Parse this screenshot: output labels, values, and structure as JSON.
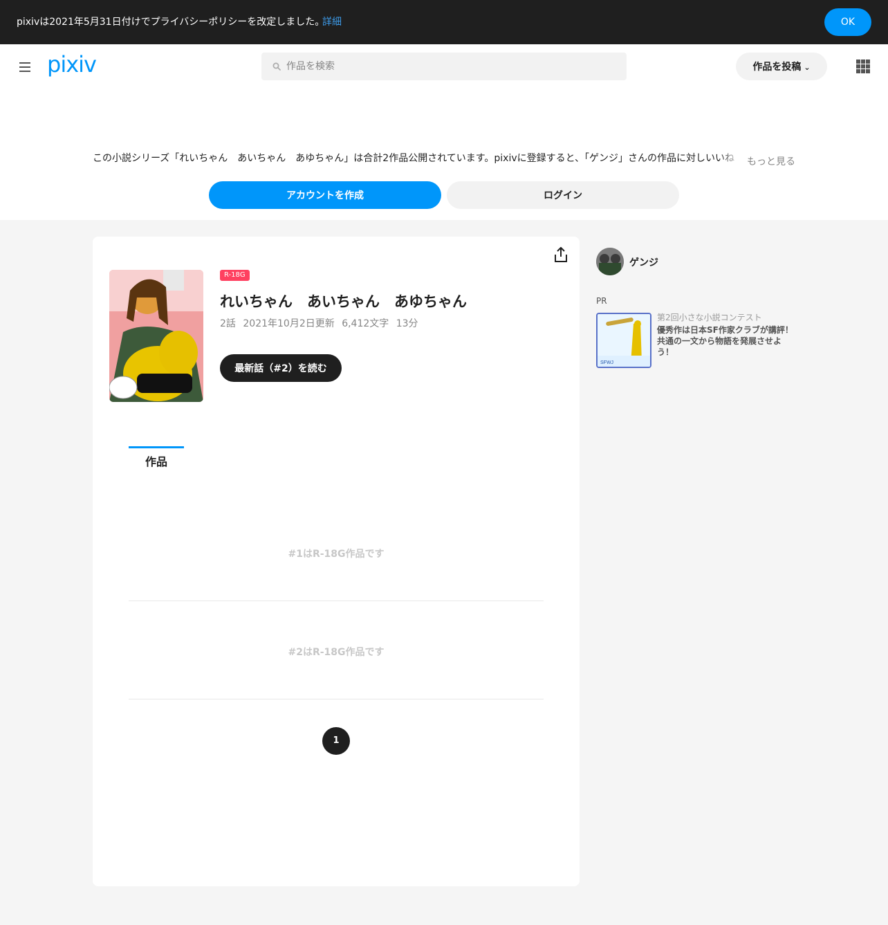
{
  "notice": {
    "text": "pixivは2021年5月31日付けでプライバシーポリシーを改定しました。",
    "link": "詳細",
    "ok": "OK"
  },
  "header": {
    "logo": "pixiv",
    "search_placeholder": "作品を検索",
    "post_button": "作品を投稿"
  },
  "promo": {
    "text": "この小説シリーズ「れいちゃん　あいちゃん　あゆちゃん」は合計2作品公開されています。pixivに登録すると、「ゲンジ」さんの作品に対しいいね",
    "more": "もっと見る",
    "create_account": "アカウントを作成",
    "login": "ログイン"
  },
  "series": {
    "rating": "R-18G",
    "title": "れいちゃん　あいちゃん　あゆちゃん",
    "episodes_count": "2話",
    "updated": "2021年10月2日更新",
    "chars": "6,412文字",
    "read_time": "13分",
    "read_latest": "最新話（#2）を読む"
  },
  "tabs": {
    "works": "作品"
  },
  "episodes": [
    {
      "text": "#1はR-18G作品です"
    },
    {
      "text": "#2はR-18G作品です"
    }
  ],
  "pagination": {
    "current": "1"
  },
  "sidebar": {
    "author_name": "ゲンジ",
    "pr_label": "PR",
    "pr_subtitle": "第2回小さな小説コンテスト",
    "pr_desc": "優秀作は日本SF作家クラブが講評！共通の一文から物語を発展させよう！"
  },
  "colors": {
    "accent": "#0096fa",
    "rating": "#ff4060",
    "dark": "#1f1f1f"
  }
}
